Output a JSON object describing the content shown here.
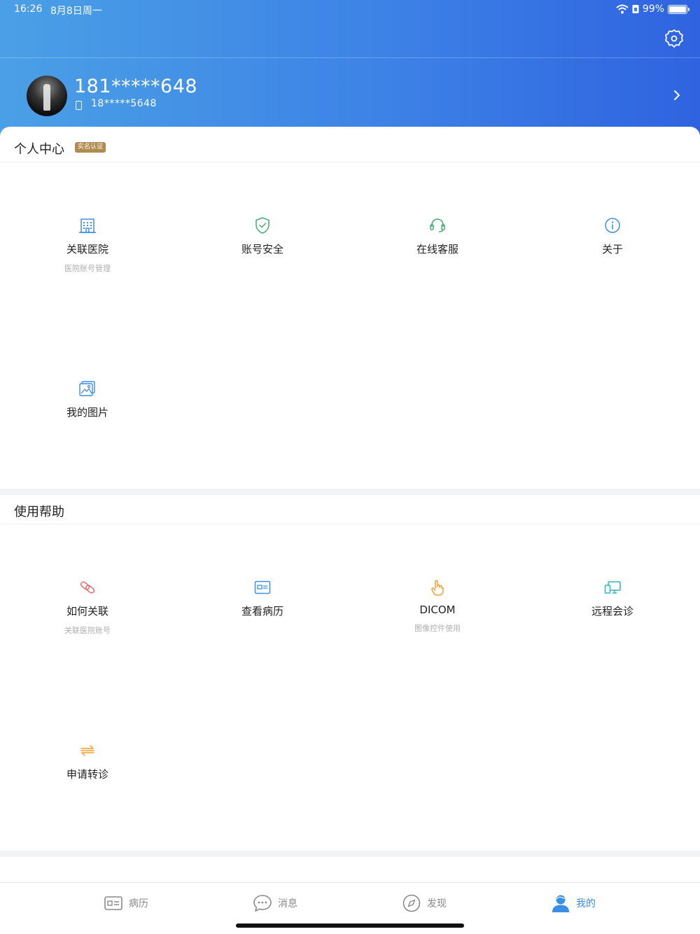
{
  "status_bar": {
    "time": "16:26",
    "date": "8月8日周一",
    "battery_text": "99%",
    "icons": [
      "wifi-icon",
      "lock-icon",
      "battery-icon"
    ]
  },
  "profile": {
    "name": "181*****648",
    "phone": "18*****5648"
  },
  "personal_center": {
    "title": "个人中心",
    "badge": "实名认证",
    "items": [
      {
        "label": "关联医院",
        "sub": "医院账号管理",
        "icon": "hospital-icon",
        "color": "#3a8fe4"
      },
      {
        "label": "账号安全",
        "sub": "",
        "icon": "shield-check-icon",
        "color": "#3fae6e"
      },
      {
        "label": "在线客服",
        "sub": "",
        "icon": "headset-icon",
        "color": "#3fae6e"
      },
      {
        "label": "关于",
        "sub": "",
        "icon": "info-icon",
        "color": "#3a8fe4"
      },
      {
        "label": "我的图片",
        "sub": "",
        "icon": "image-icon",
        "color": "#3a8fe4"
      }
    ]
  },
  "help": {
    "title": "使用帮助",
    "items": [
      {
        "label": "如何关联",
        "sub": "关联医院账号",
        "icon": "link-icon",
        "color": "#e86b6b"
      },
      {
        "label": "查看病历",
        "sub": "",
        "icon": "medical-record-icon",
        "color": "#3a8fe4"
      },
      {
        "label": "DICOM",
        "sub": "图像控件使用",
        "icon": "touch-icon",
        "color": "#f0a030"
      },
      {
        "label": "远程会诊",
        "sub": "",
        "icon": "remote-consult-icon",
        "color": "#2bb5b5"
      },
      {
        "label": "申请转诊",
        "sub": "",
        "icon": "transfer-icon",
        "color": "#f0a030"
      }
    ]
  },
  "tabbar": {
    "tabs": [
      {
        "label": "病历",
        "icon": "record-card-icon",
        "active": false
      },
      {
        "label": "消息",
        "icon": "chat-bubble-icon",
        "active": false
      },
      {
        "label": "发现",
        "icon": "compass-icon",
        "active": false
      },
      {
        "label": "我的",
        "icon": "user-icon",
        "active": true
      }
    ],
    "active_color": "#3a8fe4",
    "inactive_color": "#8a8a8a"
  }
}
